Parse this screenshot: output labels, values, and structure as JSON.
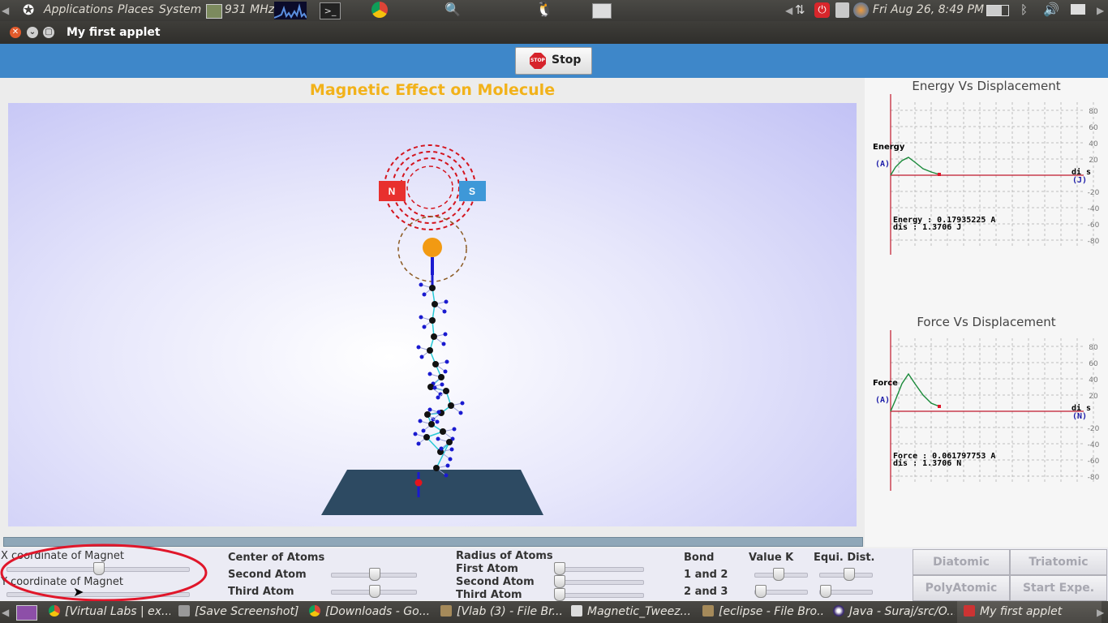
{
  "top_panel": {
    "menus": [
      "Applications",
      "Places",
      "System"
    ],
    "cpu_freq": "931 MHz",
    "clock": "Fri Aug 26,  8:49 PM"
  },
  "window": {
    "title": "My first applet"
  },
  "toolbar": {
    "stop_label": "Stop",
    "stop_icon_text": "STOP"
  },
  "simulation": {
    "title": "Magnetic Effect on Molecule",
    "magnet_north": "N",
    "magnet_south": "S"
  },
  "graphs": {
    "energy": {
      "title": "Energy Vs Displacement",
      "y_name": "Energy",
      "y_unit": "(A)",
      "x_name": "di s",
      "x_unit": "(J)",
      "ticks": [
        80,
        60,
        40,
        20,
        -20,
        -40,
        -60,
        -80
      ],
      "readout_1": "Energy : 0.17935225 A",
      "readout_2": "dis : 1.3706 J"
    },
    "force": {
      "title": "Force Vs Displacement",
      "y_name": "Force",
      "y_unit": "(A)",
      "x_name": "di s",
      "x_unit": "(N)",
      "ticks": [
        80,
        60,
        40,
        20,
        -20,
        -40,
        -60,
        -80
      ],
      "readout_1": "Force : 0.061797753 A",
      "readout_2": "dis : 1.3706 N"
    }
  },
  "controls": {
    "x_magnet_label": "X coordinate of Magnet",
    "y_magnet_label": "Y coordinate of Magnet",
    "center_of_atoms": "Center of Atoms",
    "second_atom": "Second Atom",
    "third_atom": "Third Atom",
    "radius_of_atoms": "Radius of Atoms",
    "first_atom": "First Atom",
    "radius_second_atom": "Second Atom",
    "radius_third_atom": "Third Atom",
    "bond": "Bond",
    "bond_1_2": "1 and 2",
    "bond_2_3": "2 and 3",
    "value_k": "Value K",
    "equi_dist": "Equi. Dist.",
    "buttons": [
      "Diatomic",
      "Triatomic",
      "PolyAtomic",
      "Start Expe."
    ]
  },
  "taskbar": {
    "items": [
      "[Virtual Labs | ex...",
      "[Save Screenshot]",
      "[Downloads - Go...",
      "[Vlab (3) - File Br...",
      "Magnetic_Tweez...",
      "[eclipse - File Bro...",
      "Java - Suraj/src/O...",
      "My first applet"
    ]
  },
  "colors": {
    "accent_blue": "#3e87c9",
    "title_orange": "#f2b21a",
    "graph_line": "#1a8a3a",
    "axis_red": "#c0182c",
    "annotation_red": "#e0162a"
  }
}
